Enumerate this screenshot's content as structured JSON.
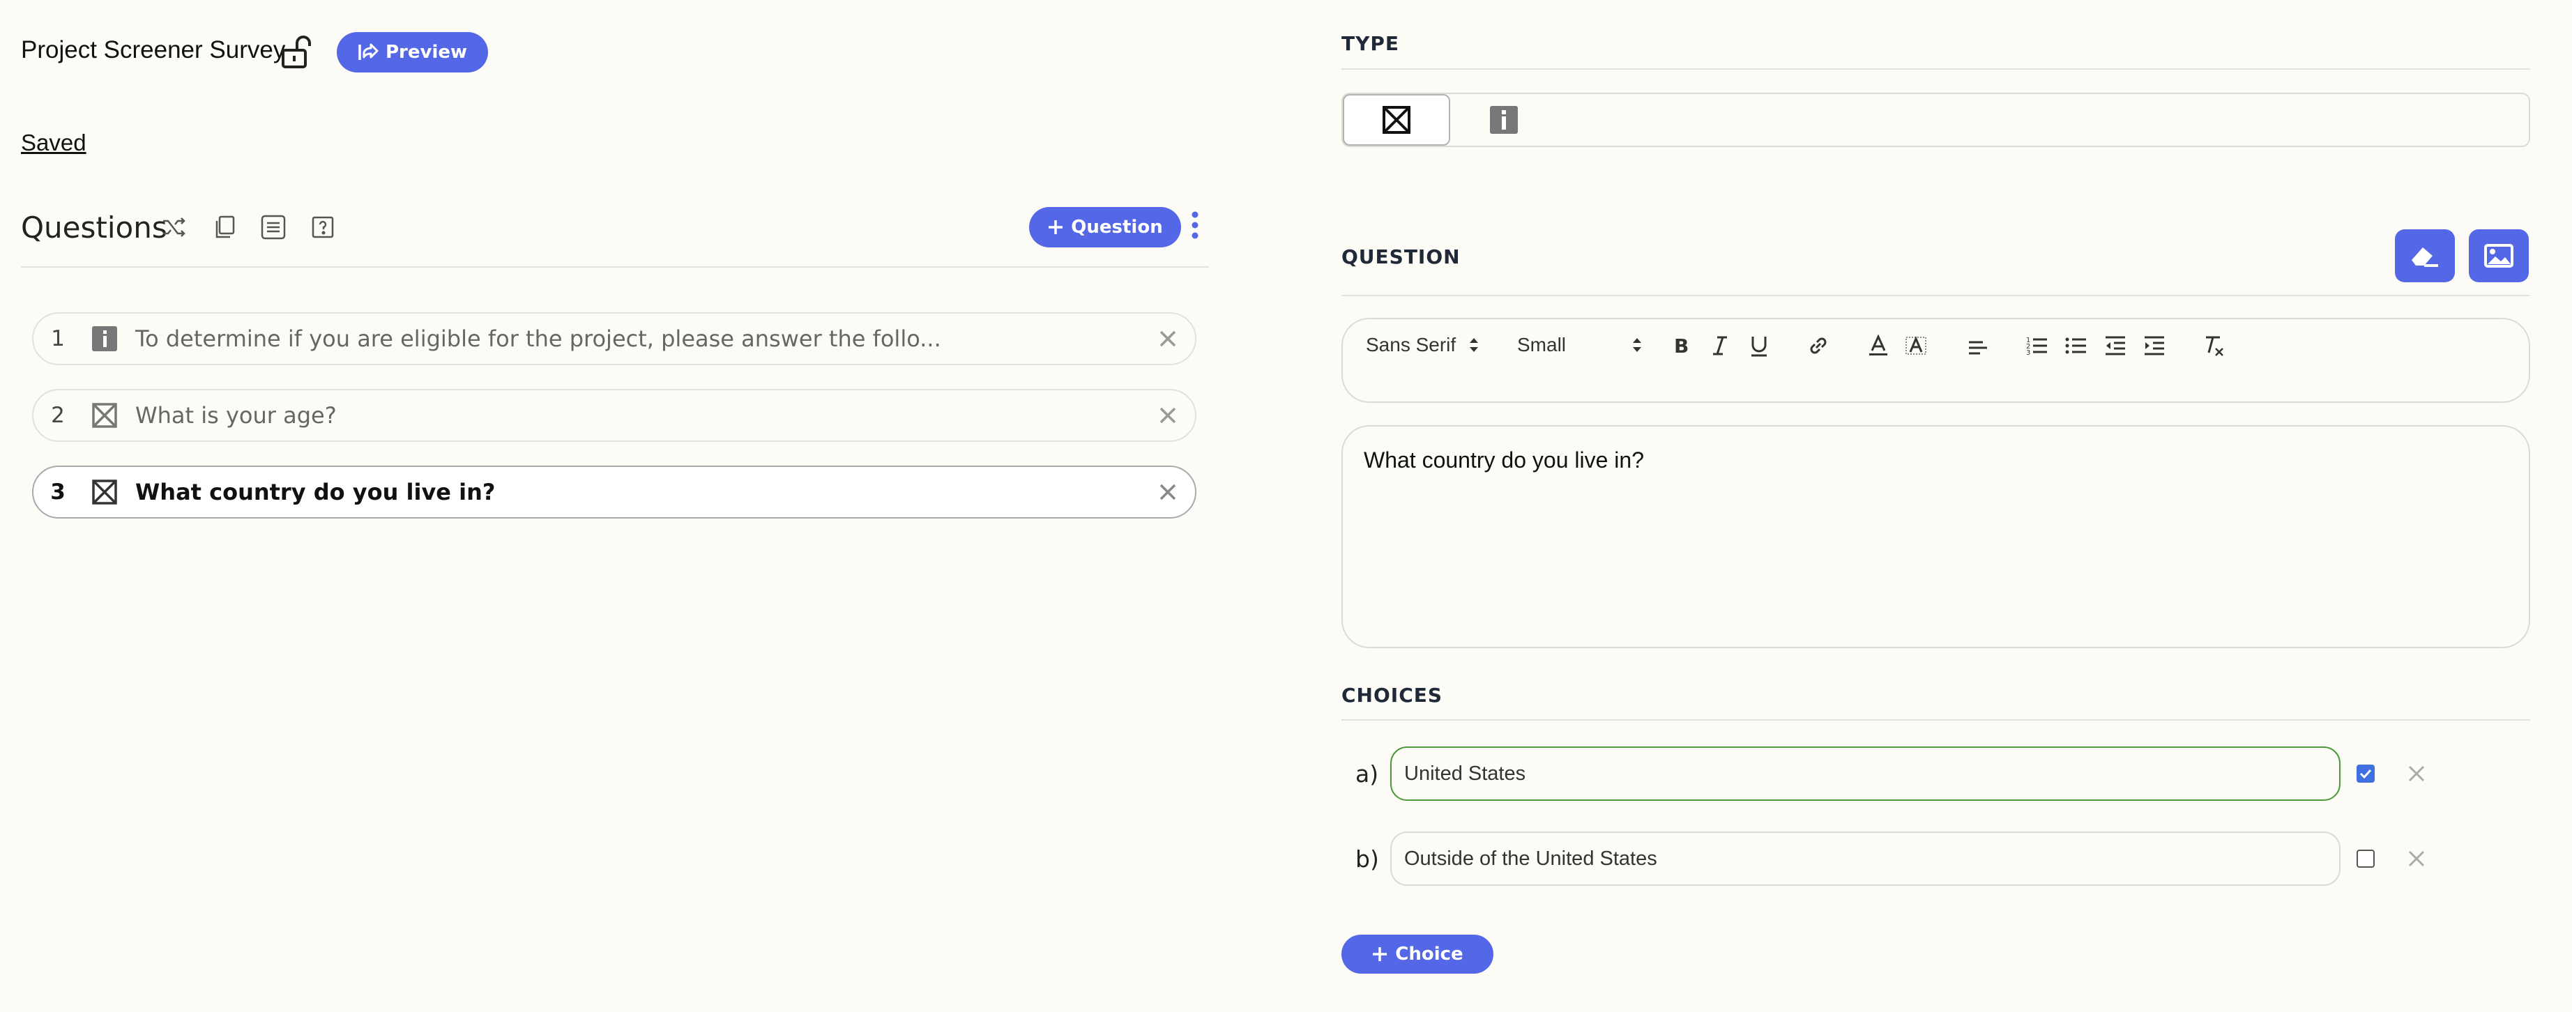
{
  "header": {
    "survey_title": "Project Screener Survey",
    "preview_label": "Preview",
    "save_status": "Saved"
  },
  "questions_panel": {
    "heading": "Questions",
    "add_question_label": "Question",
    "tools": [
      "shuffle-icon",
      "copy-icon",
      "list-icon",
      "help-icon"
    ],
    "items": [
      {
        "number": "1",
        "type": "info",
        "text": "To determine if you are eligible for the project, please answer the follo..."
      },
      {
        "number": "2",
        "type": "multiple-choice",
        "text": "What is your age?"
      },
      {
        "number": "3",
        "type": "multiple-choice",
        "text": "What country do you live in?",
        "selected": true
      }
    ]
  },
  "editor": {
    "type_label": "TYPE",
    "type_options": [
      "multiple-choice-icon",
      "info-icon"
    ],
    "selected_type": "multiple-choice-icon",
    "question_label": "QUESTION",
    "toolbar": {
      "font": "Sans Serif",
      "size": "Small",
      "buttons": [
        "bold-icon",
        "italic-icon",
        "underline-icon",
        "link-icon",
        "font-color-icon",
        "highlight-icon",
        "align-icon",
        "ordered-list-icon",
        "bullet-list-icon",
        "outdent-icon",
        "indent-icon",
        "clear-format-icon"
      ]
    },
    "question_text": "What country do you live in?",
    "choices_label": "CHOICES",
    "choices": [
      {
        "letter": "a)",
        "value": "United States",
        "checked": true
      },
      {
        "letter": "b)",
        "value": "Outside of the United States",
        "checked": false
      }
    ],
    "add_choice_label": "Choice"
  },
  "colors": {
    "accent": "#5468e7",
    "background": "#fcfbf6",
    "correct_border": "#4c9a3a",
    "checkbox": "#3f6fe0"
  }
}
